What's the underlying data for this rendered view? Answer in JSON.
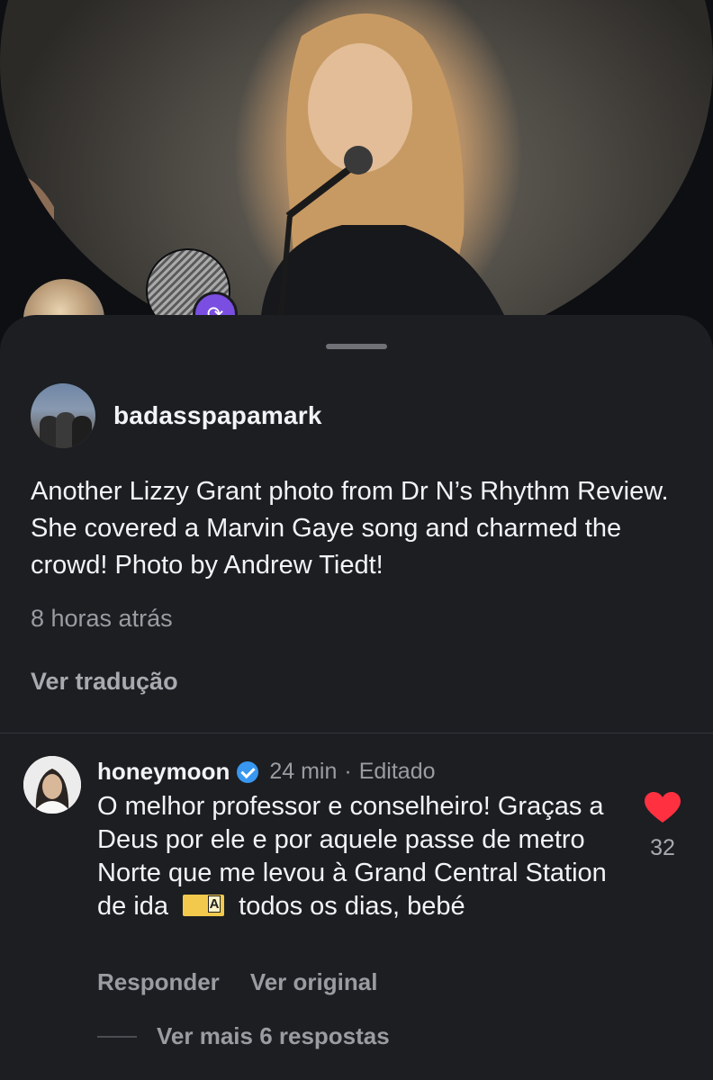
{
  "post": {
    "username": "badasspapamark",
    "caption": "Another Lizzy Grant photo from Dr N’s Rhythm Review. She covered a Marvin Gaye song and charmed the crowd! Photo by Andrew Tiedt!",
    "time": "8 horas atrás",
    "see_translation": "Ver tradução"
  },
  "comment": {
    "username": "honeymoon",
    "time": "24 min",
    "separator": "·",
    "edited": "Editado",
    "text_before_emoji": "O melhor professor e conselheiro! Graças a Deus por ele e por aquele passe de metro Norte que me levou à Grand Central Station de ida",
    "text_after_emoji": "todos os dias, bebé",
    "like_count": "32",
    "like_color": "#ff3040",
    "reply_label": "Responder",
    "see_original_label": "Ver original",
    "view_replies_label": "Ver mais 6 respostas"
  }
}
